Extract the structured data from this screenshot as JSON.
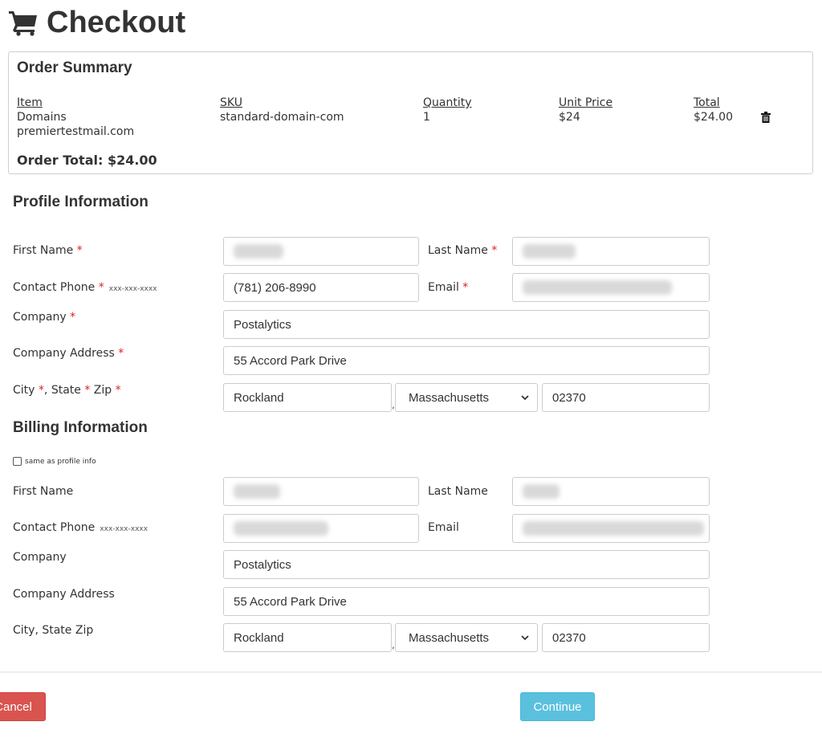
{
  "page": {
    "title": "Checkout",
    "cart_icon": "shopping-cart-icon"
  },
  "order_summary": {
    "heading": "Order Summary",
    "columns": [
      "Item",
      "SKU",
      "Quantity",
      "Unit Price",
      "Total"
    ],
    "items": [
      {
        "item": "Domains",
        "item_detail": "premiertestmail.com",
        "sku": "standard-domain-com",
        "quantity": "1",
        "unit_price": "$24",
        "total": "$24.00",
        "delete_icon": "trash-icon"
      }
    ],
    "order_total": "Order Total: $24.00"
  },
  "profile": {
    "heading": "Profile Information",
    "first_name_label": "First Name",
    "last_name_label": "Last Name",
    "contact_phone_label": "Contact Phone",
    "phone_hint": "xxx-xxx-xxxx",
    "email_label": "Email",
    "company_label": "Company",
    "company_address_label": "Company Address",
    "city_label": "City",
    "state_label": "State",
    "zip_label": "Zip",
    "required_mark": "*",
    "first_name": "",
    "last_name": "",
    "contact_phone": "(781) 206-8990",
    "email": "",
    "company": "Postalytics",
    "company_address": "55 Accord Park Drive",
    "city": "Rockland",
    "state": "Massachusetts",
    "zip": "02370"
  },
  "billing": {
    "heading": "Billing Information",
    "same_as_profile_label": "same as profile info",
    "same_as_profile_checked": false,
    "first_name_label": "First Name",
    "last_name_label": "Last Name",
    "contact_phone_label": "Contact Phone",
    "phone_hint": "xxx-xxx-xxxx",
    "email_label": "Email",
    "company_label": "Company",
    "company_address_label": "Company Address",
    "city_state_zip_label": "City, State Zip",
    "company": "Postalytics",
    "company_address": "55 Accord Park Drive",
    "city": "Rockland",
    "state": "Massachusetts",
    "zip": "02370"
  },
  "actions": {
    "cancel_label": "Cancel",
    "continue_label": "Continue"
  },
  "colors": {
    "required": "#d9231e",
    "cancel": "#d9534f",
    "continue": "#5bc0de"
  }
}
